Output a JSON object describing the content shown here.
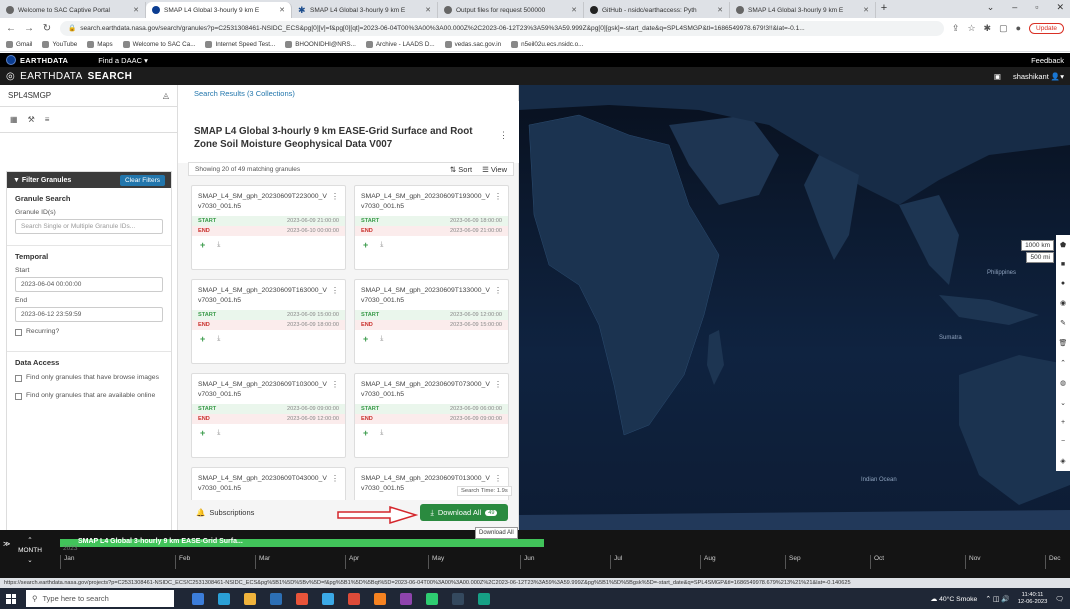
{
  "browser": {
    "tabs": [
      {
        "title": "Welcome to SAC Captive Portal",
        "icon": "globe-icon"
      },
      {
        "title": "SMAP L4 Global 3-hourly 9 km E",
        "icon": "nasa-icon",
        "active": true
      },
      {
        "title": "SMAP L4 Global 3-hourly 9 km E",
        "icon": "star-icon"
      },
      {
        "title": "Output files for request 500000",
        "icon": "globe-icon"
      },
      {
        "title": "GitHub - nsidc/earthaccess: Pyth",
        "icon": "github-icon"
      },
      {
        "title": "SMAP L4 Global 3-hourly 9 km E",
        "icon": "globe-icon"
      }
    ],
    "url": "search.earthdata.nasa.gov/search/granules?p=C2531308461-NSIDC_ECS&pg[0][v]=f&pg[0][qt]=2023-06-04T00%3A00%3A00.000Z%2C2023-06-12T23%3A59%3A59.999Z&pg[0][gsk]=-start_date&q=SPL4SMGP&tl=1686549978.679!3!!&lat=-0.1...",
    "update_label": "Update",
    "bookmarks": [
      "Gmail",
      "YouTube",
      "Maps",
      "Welcome to SAC Ca...",
      "Internet Speed Test...",
      "BHOONIDHI@NRS...",
      "Archive - LAADS D...",
      "vedas.sac.gov.in",
      "n5eil02u.ecs.nsidc.o..."
    ]
  },
  "earthdata": {
    "brand": "EARTHDATA",
    "find_daac": "Find a DAAC",
    "feedback": "Feedback",
    "search_brand_a": "EARTHDATA",
    "search_brand_b": "SEARCH",
    "user": "shashikant"
  },
  "sidebar": {
    "search_value": "SPL4SMGP",
    "filter_title": "Filter Granules",
    "clear_filters": "Clear Filters",
    "granule_search_title": "Granule Search",
    "granule_ids_label": "Granule ID(s)",
    "granule_ids_placeholder": "Search Single or Multiple Granule IDs...",
    "temporal_title": "Temporal",
    "start_label": "Start",
    "start_value": "2023-06-04 00:00:00",
    "end_label": "End",
    "end_value": "2023-06-12 23:59:59",
    "recurring_label": "Recurring?",
    "data_access_title": "Data Access",
    "browse_label": "Find only granules that have browse images",
    "online_label": "Find only granules that are available online"
  },
  "results": {
    "header": "Search Results (3 Collections)",
    "collection_title": "SMAP L4 Global 3-hourly 9 km EASE-Grid Surface and Root Zone Soil Moisture Geophysical Data V007",
    "showing": "Showing 20 of 49 matching granules",
    "sort_label": "Sort",
    "view_label": "View",
    "start_key": "START",
    "end_key": "END",
    "granules": [
      {
        "name": "SMAP_L4_SM_gph_20230609T223000_Vv7030_001.h5",
        "start": "2023-06-09 21:00:00",
        "end": "2023-06-10 00:00:00"
      },
      {
        "name": "SMAP_L4_SM_gph_20230609T193000_Vv7030_001.h5",
        "start": "2023-06-09 18:00:00",
        "end": "2023-06-09 21:00:00"
      },
      {
        "name": "SMAP_L4_SM_gph_20230609T163000_Vv7030_001.h5",
        "start": "2023-06-09 15:00:00",
        "end": "2023-06-09 18:00:00"
      },
      {
        "name": "SMAP_L4_SM_gph_20230609T133000_Vv7030_001.h5",
        "start": "2023-06-09 12:00:00",
        "end": "2023-06-09 15:00:00"
      },
      {
        "name": "SMAP_L4_SM_gph_20230609T103000_Vv7030_001.h5",
        "start": "2023-06-09 09:00:00",
        "end": "2023-06-09 12:00:00"
      },
      {
        "name": "SMAP_L4_SM_gph_20230609T073000_Vv7030_001.h5",
        "start": "2023-06-09 06:00:00",
        "end": "2023-06-09 09:00:00"
      },
      {
        "name": "SMAP_L4_SM_gph_20230609T043000_Vv7030_001.h5"
      },
      {
        "name": "SMAP_L4_SM_gph_20230609T013000_Vv7030_001.h5"
      }
    ],
    "search_time": "Search Time: 1.9s",
    "subscriptions": "Subscriptions",
    "download_all": "Download All",
    "download_count": "49",
    "tooltip": "Download All"
  },
  "map": {
    "scale_km": "1000 km",
    "scale_mi": "500 mi",
    "labels": [
      "Indian Ocean",
      "Philippines",
      "Sumatra"
    ]
  },
  "timeline": {
    "zoom_label": "MONTH",
    "year": "2023",
    "collection_bar": "SMAP L4 Global 3-hourly 9 km EASE-Grid Surfa...",
    "months": [
      "Jan",
      "Feb",
      "Mar",
      "Apr",
      "May",
      "Jun",
      "Jul",
      "Aug",
      "Sep",
      "Oct",
      "Nov",
      "Dec"
    ],
    "status_url": "https://search.earthdata.nasa.gov/projects?p=C2531308461-NSIDC_ECS!C2531308461-NSIDC_ECS&pg%5B1%5D%5Bv%5D=f&pg%5B1%5D%5Bqt%5D=2023-06-04T00%3A00%3A00.000Z%2C2023-06-12T23%3A59%3A59.999Z&pg%5B1%5D%5Bgsk%5D=-start_date&q=SPL4SMGP&tl=1686549978.679%213%21%21&lat=-0.140625"
  },
  "taskbar": {
    "search_placeholder": "Type here to search",
    "weather": "40°C Smoke",
    "time": "11:40:11",
    "date": "12-06-2023"
  }
}
